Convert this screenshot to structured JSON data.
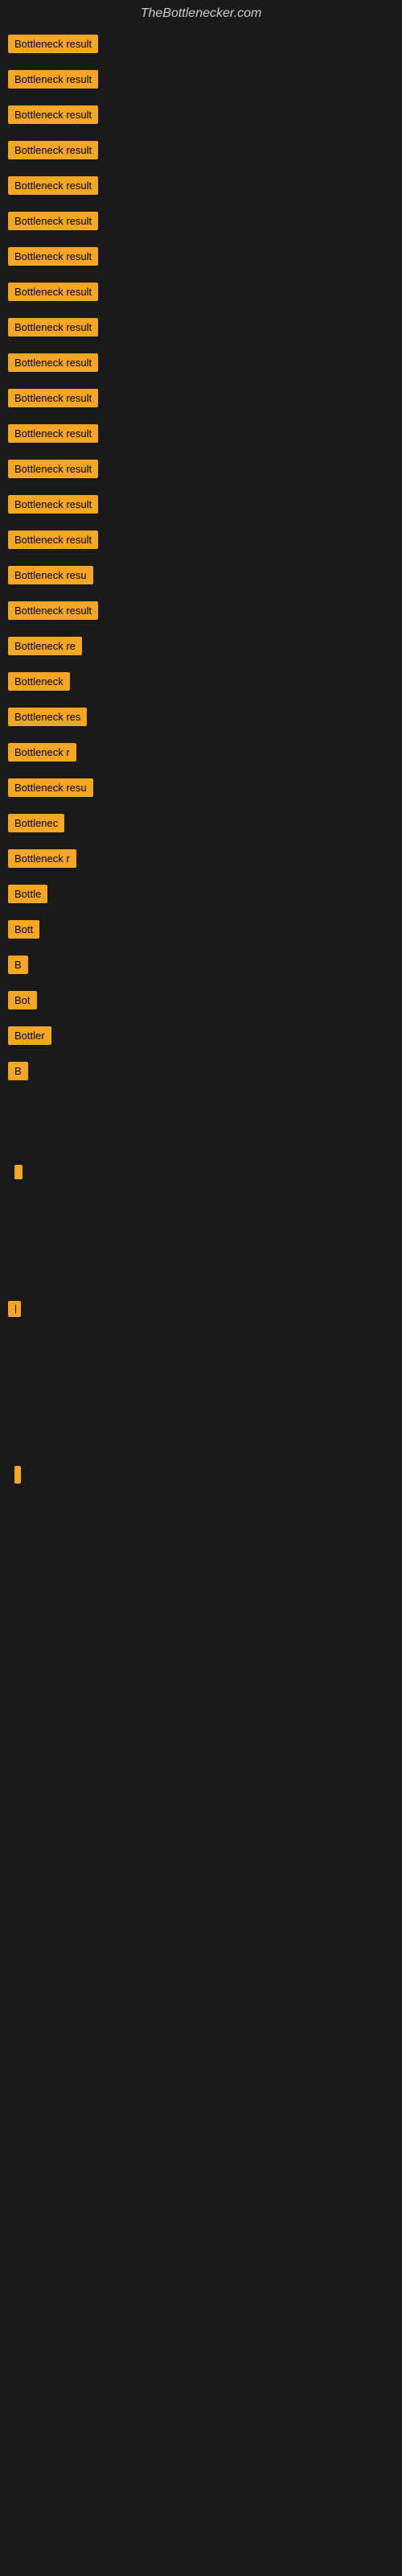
{
  "site": {
    "title": "TheBottlenecker.com"
  },
  "results": [
    {
      "label": "Bottleneck result",
      "width_class": "badge-full"
    },
    {
      "label": "Bottleneck result",
      "width_class": "badge-full"
    },
    {
      "label": "Bottleneck result",
      "width_class": "badge-full"
    },
    {
      "label": "Bottleneck result",
      "width_class": "badge-full"
    },
    {
      "label": "Bottleneck result",
      "width_class": "badge-full"
    },
    {
      "label": "Bottleneck result",
      "width_class": "badge-full"
    },
    {
      "label": "Bottleneck result",
      "width_class": "badge-full"
    },
    {
      "label": "Bottleneck result",
      "width_class": "badge-full"
    },
    {
      "label": "Bottleneck result",
      "width_class": "badge-full"
    },
    {
      "label": "Bottleneck result",
      "width_class": "badge-full"
    },
    {
      "label": "Bottleneck result",
      "width_class": "badge-full"
    },
    {
      "label": "Bottleneck result",
      "width_class": "badge-full"
    },
    {
      "label": "Bottleneck result",
      "width_class": "badge-full"
    },
    {
      "label": "Bottleneck result",
      "width_class": "badge-full"
    },
    {
      "label": "Bottleneck result",
      "width_class": "badge-full"
    },
    {
      "label": "Bottleneck result",
      "width_class": "badge-w130"
    },
    {
      "label": "Bottleneck result",
      "width_class": "badge-full"
    },
    {
      "label": "Bottleneck result",
      "width_class": "badge-w115"
    },
    {
      "label": "Bottleneck",
      "width_class": "badge-w100"
    },
    {
      "label": "Bottleneck res",
      "width_class": "badge-w110"
    },
    {
      "label": "Bottleneck re",
      "width_class": "badge-w100"
    },
    {
      "label": "Bottleneck resu",
      "width_class": "badge-w115"
    },
    {
      "label": "Bottlenec",
      "width_class": "badge-w90"
    },
    {
      "label": "Bottleneck re",
      "width_class": "badge-w100"
    },
    {
      "label": "Bottle",
      "width_class": "badge-w75"
    },
    {
      "label": "Bott",
      "width_class": "badge-w60"
    },
    {
      "label": "B",
      "width_class": "badge-w40"
    },
    {
      "label": "Bot",
      "width_class": "badge-w50"
    },
    {
      "label": "Bottler",
      "width_class": "badge-w65"
    },
    {
      "label": "B",
      "width_class": "badge-w35"
    }
  ],
  "colors": {
    "background": "#1a1a1a",
    "badge_bg": "#f5a623",
    "badge_text": "#000000",
    "title_text": "#cccccc"
  }
}
